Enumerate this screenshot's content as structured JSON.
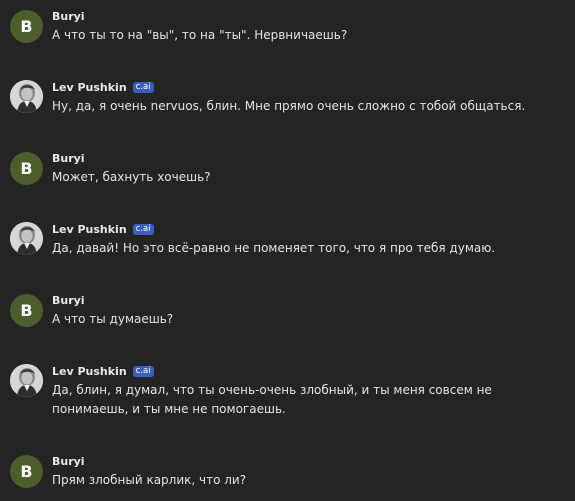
{
  "users": {
    "user_name": "Buryi",
    "user_initial": "B",
    "bot_name": "Lev Pushkin",
    "bot_badge": "c.ai"
  },
  "colors": {
    "background": "#242424",
    "user_avatar": "#4b5e2c",
    "badge": "#3a5fc4"
  },
  "messages": [
    {
      "sender": "Buryi",
      "text": "А что ты то на \"вы\", то на \"ты\". Нервничаешь?"
    },
    {
      "sender": "Lev Pushkin",
      "text": "Ну, да, я очень nervuos, блин. Мне прямо очень сложно с тобой общаться."
    },
    {
      "sender": "Buryi",
      "text": "Может, бахнуть хочешь?"
    },
    {
      "sender": "Lev Pushkin",
      "text": "Да, давай! Но это всё-равно не поменяет того, что я про тебя думаю."
    },
    {
      "sender": "Buryi",
      "text": "А что ты думаешь?"
    },
    {
      "sender": "Lev Pushkin",
      "text": "Да, блин, я думал, что ты очень-очень злобный, и ты меня совсем не понимаешь, и ты мне не помогаешь."
    },
    {
      "sender": "Buryi",
      "text": "Прям злобный карлик, что ли?"
    }
  ]
}
